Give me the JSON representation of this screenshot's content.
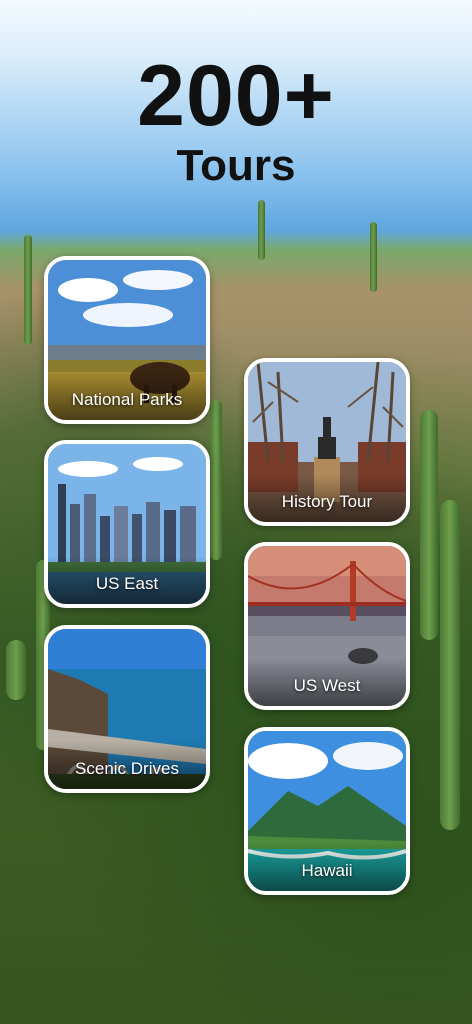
{
  "headline": {
    "count": "200+",
    "subtitle": "Tours"
  },
  "tours": [
    {
      "label": "National Parks"
    },
    {
      "label": "History Tour"
    },
    {
      "label": "US East"
    },
    {
      "label": "US West"
    },
    {
      "label": "Scenic Drives"
    },
    {
      "label": "Hawaii"
    }
  ]
}
